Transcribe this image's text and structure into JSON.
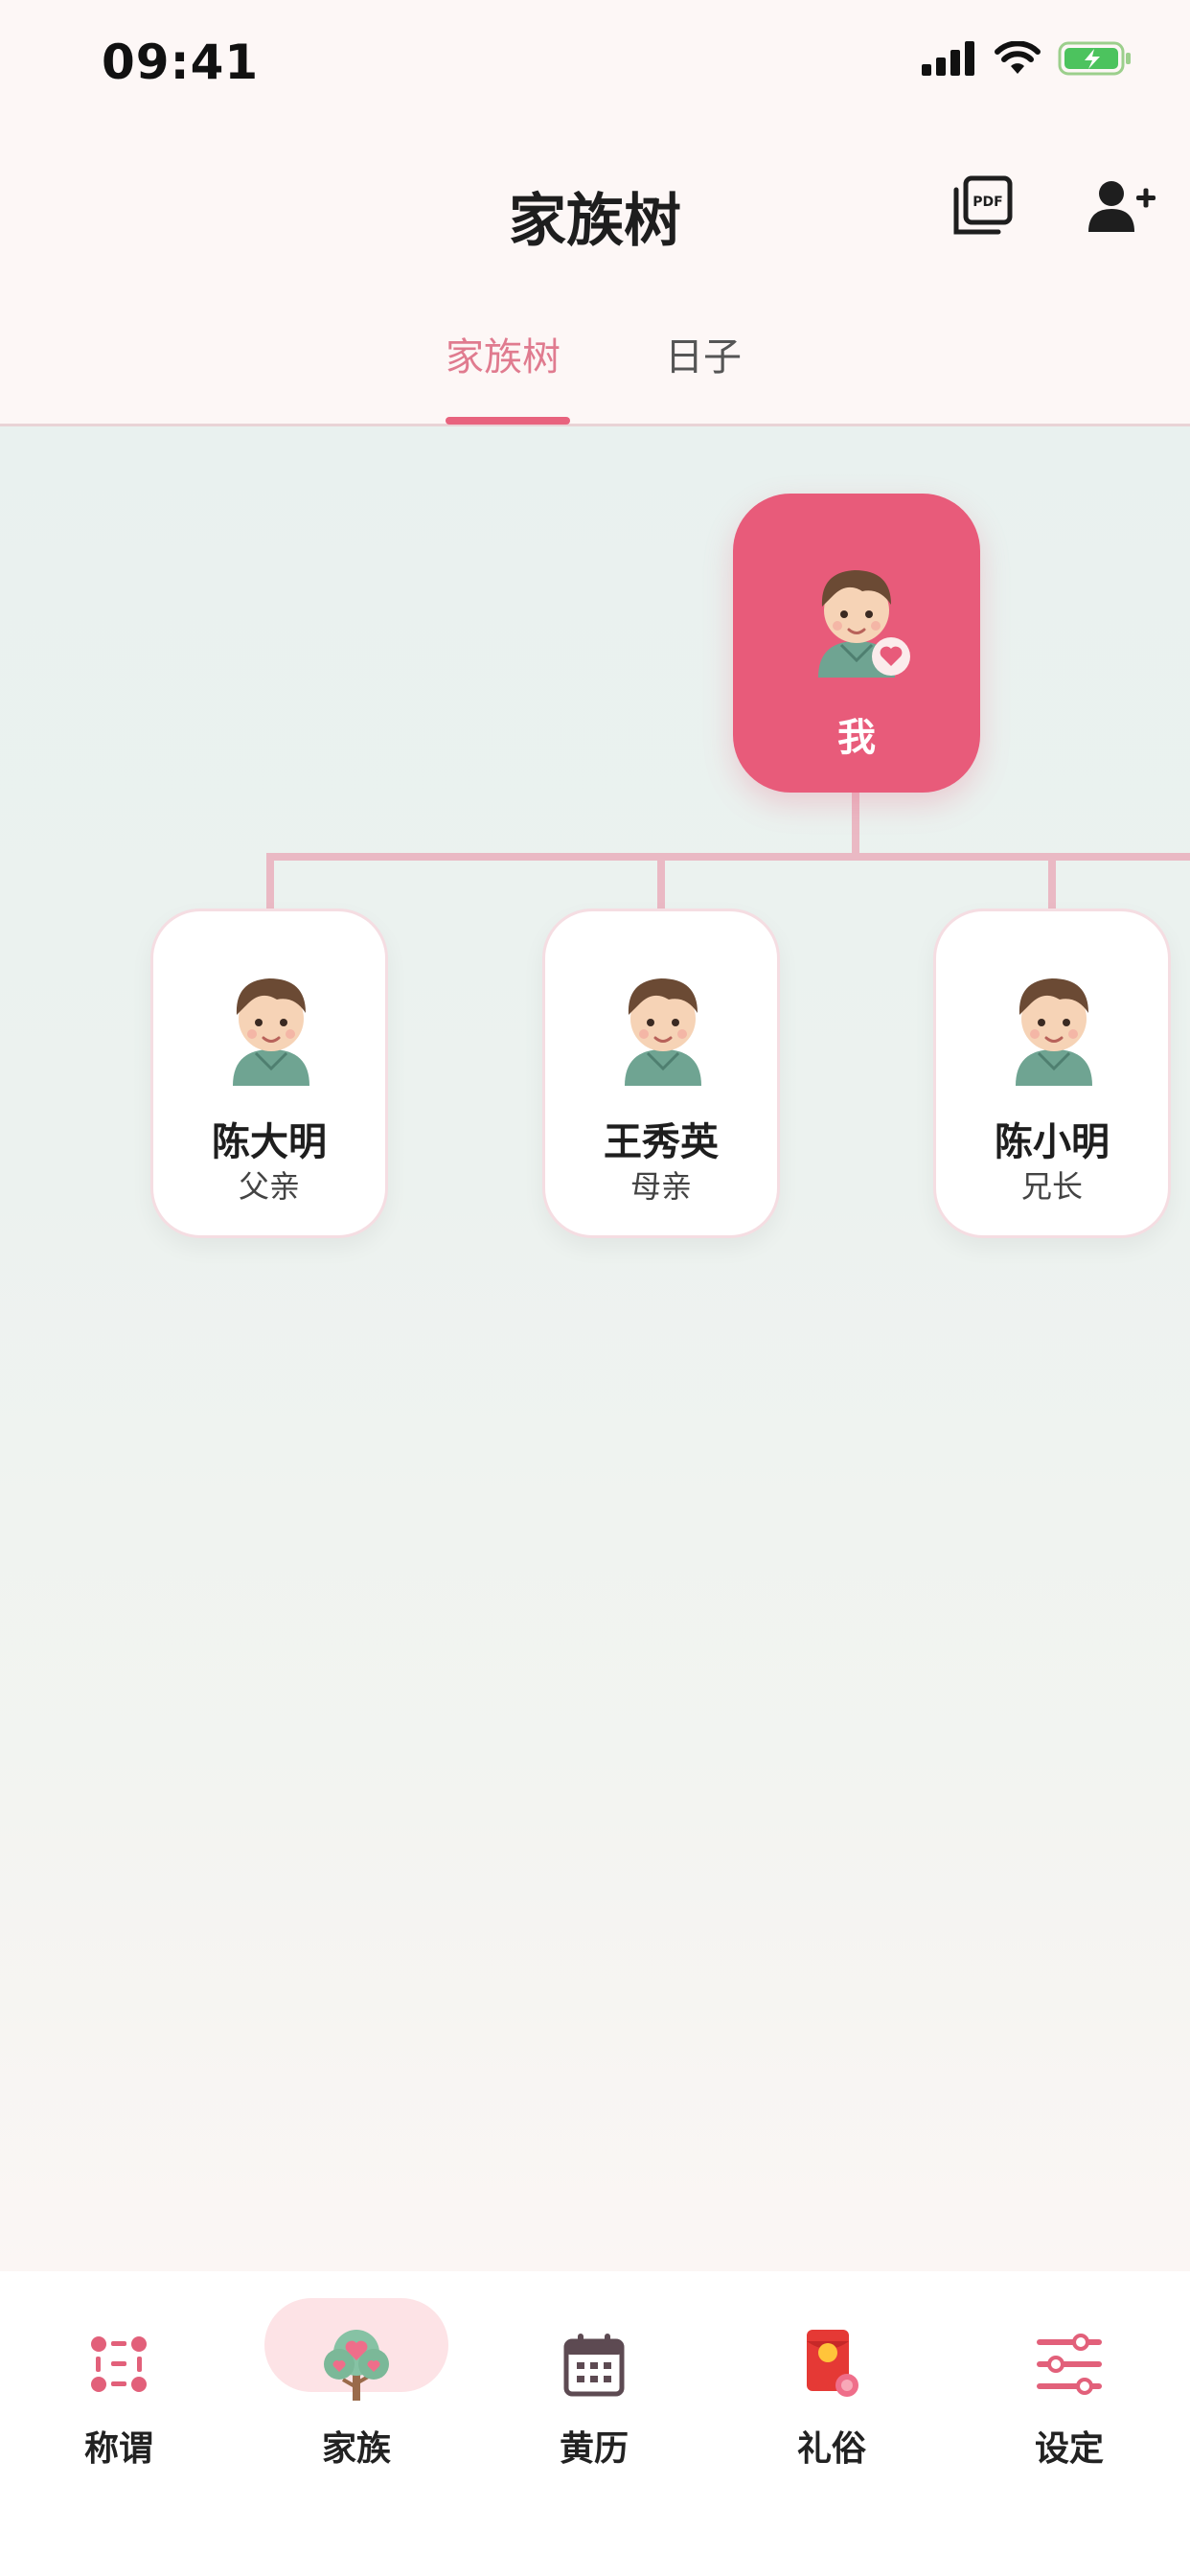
{
  "status": {
    "time": "09:41"
  },
  "header": {
    "title": "家族树",
    "pdf_text": "PDF"
  },
  "tabs": [
    {
      "label": "家族树",
      "active": true
    },
    {
      "label": "日子",
      "active": false
    }
  ],
  "tree": {
    "me": {
      "label": "我"
    },
    "members": [
      {
        "name": "陈大明",
        "relation": "父亲"
      },
      {
        "name": "王秀英",
        "relation": "母亲"
      },
      {
        "name": "陈小明",
        "relation": "兄长"
      }
    ]
  },
  "nav": [
    {
      "label": "称谓",
      "icon": "grid-icon"
    },
    {
      "label": "家族",
      "icon": "tree-icon",
      "active": true
    },
    {
      "label": "黄历",
      "icon": "calendar-icon"
    },
    {
      "label": "礼俗",
      "icon": "red-envelope-icon"
    },
    {
      "label": "设定",
      "icon": "settings-icon"
    }
  ],
  "colors": {
    "accent": "#e85b7a",
    "accent_light": "#fde3e6",
    "connector": "#eab9c4"
  }
}
